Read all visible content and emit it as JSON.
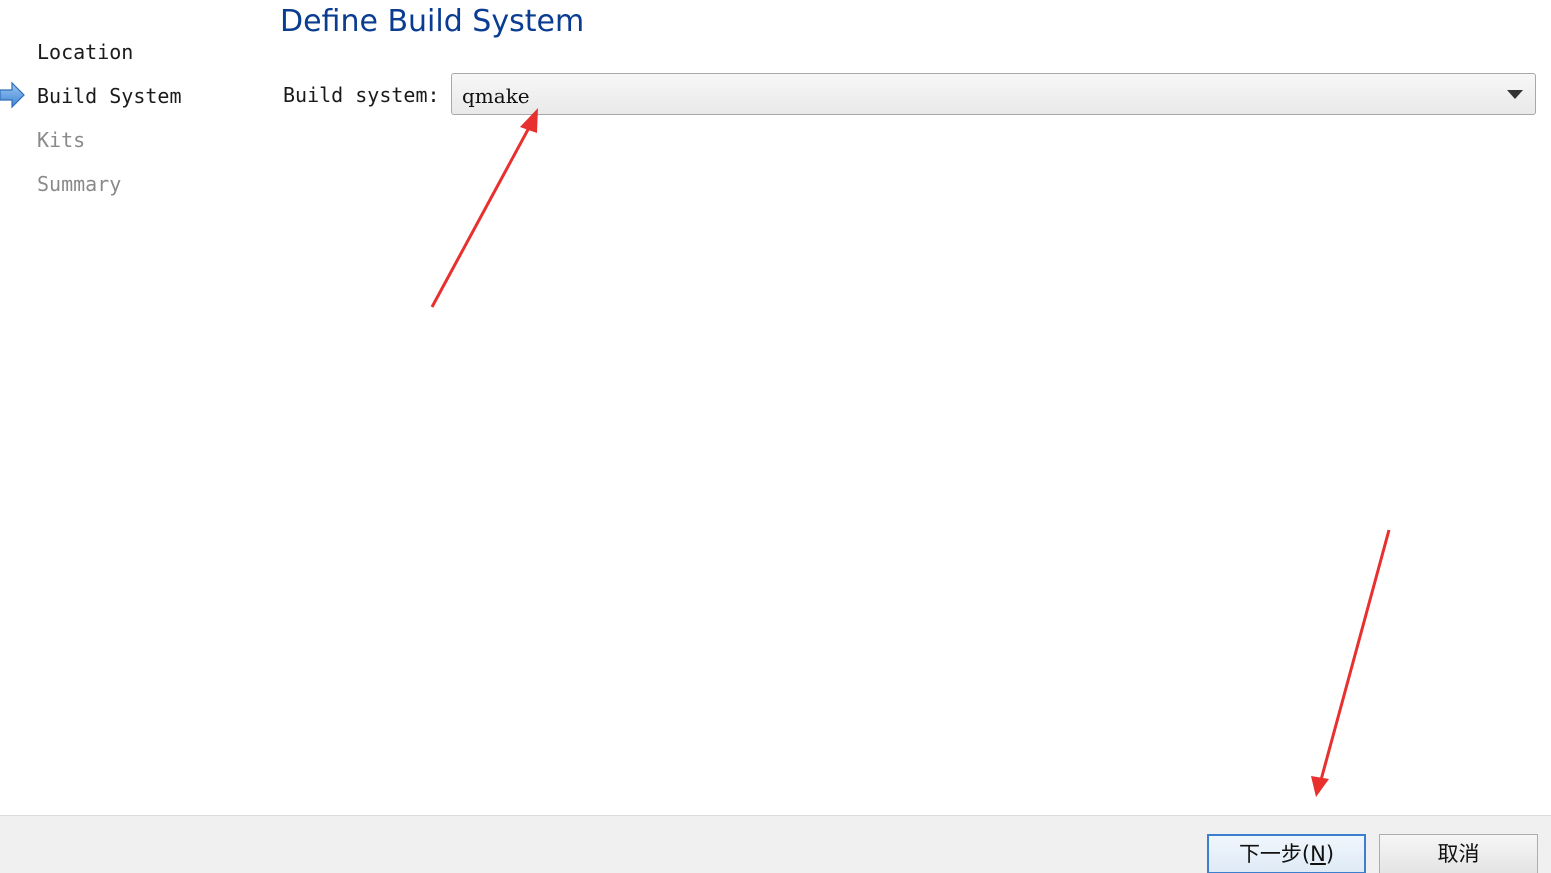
{
  "wizard": {
    "steps": [
      {
        "label": "Location",
        "state": "done"
      },
      {
        "label": "Build System",
        "state": "current"
      },
      {
        "label": "Kits",
        "state": "pending"
      },
      {
        "label": "Summary",
        "state": "pending"
      }
    ],
    "current_step_icon": "right-arrow-icon"
  },
  "page": {
    "title": "Define Build System",
    "build_system_label": "Build system:",
    "build_system_value": "qmake"
  },
  "footer": {
    "next_label_main": "下一步(",
    "next_mnemonic": "N",
    "next_label_end": ")",
    "cancel_label": "取消"
  },
  "colors": {
    "title": "#0a3d91",
    "annotation_arrow": "#e8302f",
    "footer_bg": "#f0f0f0",
    "default_button_border": "#3c7fcf"
  }
}
